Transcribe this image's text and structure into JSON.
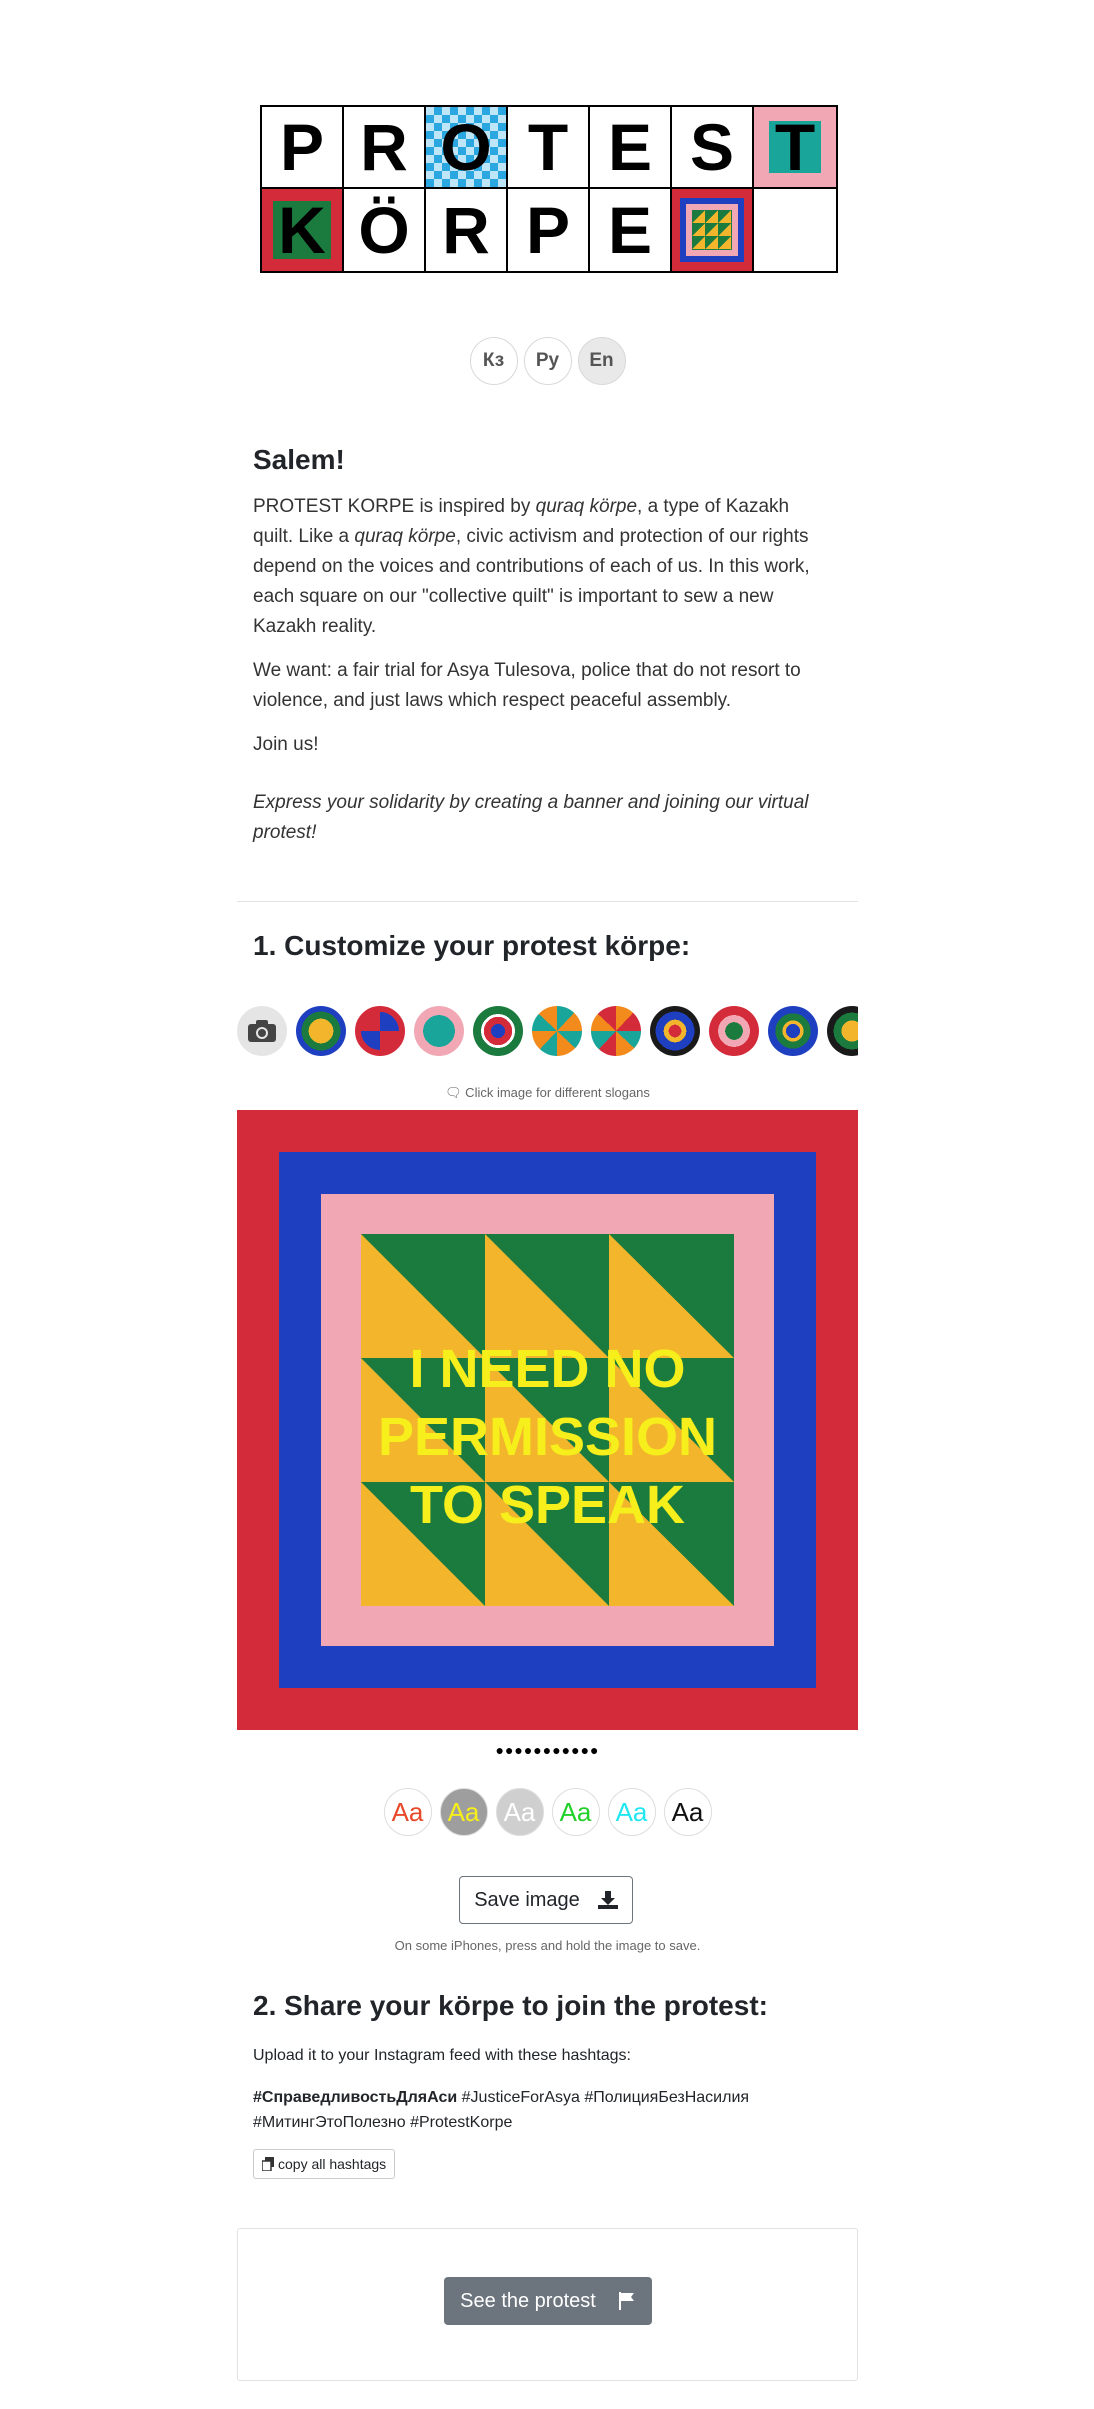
{
  "logo": {
    "row1": [
      "P",
      "R",
      "O",
      "T",
      "E",
      "S",
      "T"
    ],
    "row2": [
      "K",
      "Ö",
      "R",
      "P",
      "E",
      "",
      ""
    ]
  },
  "languages": [
    {
      "label": "Кз",
      "active": false
    },
    {
      "label": "Ру",
      "active": false
    },
    {
      "label": "En",
      "active": true
    }
  ],
  "intro": {
    "heading": "Salem!",
    "p1_a": "PROTEST KORPE is inspired by ",
    "p1_em1": "quraq körpe",
    "p1_b": ", a type of Kazakh quilt. Like a ",
    "p1_em2": "quraq körpe",
    "p1_c": ", civic activism and protection of our rights depend on the voices and contributions of each of us. In this work, each square on our \"collective quilt\" is important to sew a new Kazakh reality.",
    "p2": "We want: a fair trial for Asya Tulesova, police that do not resort to violence, and just laws which respect peaceful assembly.",
    "p3": "Join us!",
    "p4": "Express your solidarity by creating a banner and joining our virtual protest!"
  },
  "step1": {
    "heading": "1. Customize your protest körpe:",
    "hint": "🗨 Click image for different slogans",
    "slogan_lines": [
      "I NEED NO",
      "PERMISSION",
      "TO SPEAK"
    ],
    "slide_dots": "●●●●●●●●●●●",
    "font_samples": [
      {
        "label": "Aa",
        "color": "#e8492a",
        "bg": "#ffffff"
      },
      {
        "label": "Aa",
        "color": "#f6ef1b",
        "bg": "#9e9e9e"
      },
      {
        "label": "Aa",
        "color": "#ffffff",
        "bg": "#cfcfcf"
      },
      {
        "label": "Aa",
        "color": "#22d12a",
        "bg": "#ffffff"
      },
      {
        "label": "Aa",
        "color": "#22e6f0",
        "bg": "#ffffff"
      },
      {
        "label": "Aa",
        "color": "#111111",
        "bg": "#ffffff"
      }
    ],
    "save_label": "Save image",
    "save_note": "On some iPhones, press and hold the image to save."
  },
  "step2": {
    "heading": "2. Share your körpe to join the protest:",
    "upload_text": "Upload it to your Instagram feed with these hashtags:",
    "hashtag_bold": "#СправедливостьДляАси",
    "hashtags_line1": " #JusticeForAsya #ПолицияБезНасилия",
    "hashtags_line2": "#МитингЭтоПолезно #ProtestKorpe",
    "copy_label": "copy all hashtags"
  },
  "see_protest_label": "See the protest",
  "colors": {
    "red": "#d42b3a",
    "blue": "#1e3fc0",
    "pink": "#f2a8b4",
    "green": "#1b7a3e",
    "yellow": "#f2b52c",
    "slogan": "#f6ef1b",
    "button_gray": "#6c757d"
  },
  "icons": [
    "camera-icon",
    "download-icon",
    "copy-icon",
    "flag-icon",
    "speech-bubble-icon"
  ]
}
